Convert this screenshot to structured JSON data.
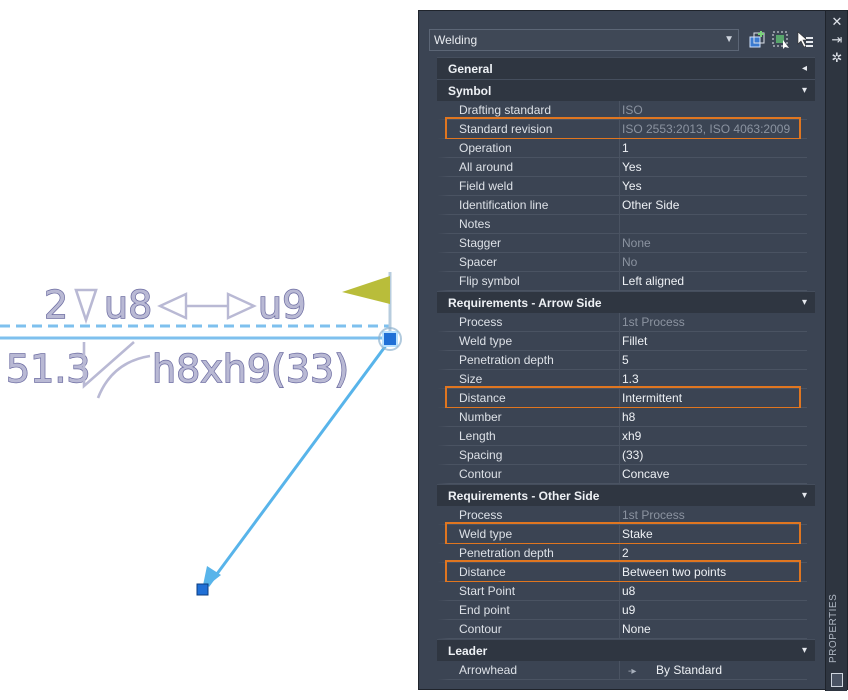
{
  "drawing": {
    "arrow_side_text": "2 u8 u9",
    "arrow_qty": "2",
    "arrow_start": "u8",
    "arrow_end": "u9",
    "other_side_size": "51.3",
    "other_side_dims": "h8xh9(33)",
    "colors": {
      "leader": "#58b4ea",
      "grip": "#1f6fd6",
      "flag": "#b9bd3a",
      "symbol_text": "#6a6aa0",
      "reference_line": "#7ec0ee"
    }
  },
  "palette": {
    "object_type": "Welding",
    "tools": [
      "quick-select-icon",
      "select-objects-icon",
      "toggle-pickadd-icon"
    ],
    "strip_label": "PROPERTIES",
    "sections": [
      {
        "title": "General",
        "toggle": "◂",
        "rows": []
      },
      {
        "title": "Symbol",
        "toggle": "▾",
        "rows": [
          {
            "label": "Drafting standard",
            "value": "ISO",
            "dim": true
          },
          {
            "label": "Standard revision",
            "value": "ISO 2553:2013, ISO 4063:2009",
            "dim": true,
            "highlight": true
          },
          {
            "label": "Operation",
            "value": "1"
          },
          {
            "label": "All around",
            "value": "Yes"
          },
          {
            "label": "Field weld",
            "value": "Yes"
          },
          {
            "label": "Identification line",
            "value": "Other Side"
          },
          {
            "label": "Notes",
            "value": ""
          },
          {
            "label": "Stagger",
            "value": "None",
            "dim": true
          },
          {
            "label": "Spacer",
            "value": "No",
            "dim": true
          },
          {
            "label": "Flip symbol",
            "value": "Left aligned"
          }
        ]
      },
      {
        "title": "Requirements - Arrow Side",
        "toggle": "▾",
        "rows": [
          {
            "label": "Process",
            "value": "1st Process",
            "dim": true
          },
          {
            "label": "Weld type",
            "value": "Fillet"
          },
          {
            "label": "Penetration depth",
            "value": "5"
          },
          {
            "label": "Size",
            "value": "1.3"
          },
          {
            "label": "Distance",
            "value": "Intermittent",
            "highlight": true
          },
          {
            "label": "Number",
            "value": "h8"
          },
          {
            "label": "Length",
            "value": "xh9"
          },
          {
            "label": "Spacing",
            "value": "(33)"
          },
          {
            "label": "Contour",
            "value": "Concave"
          }
        ]
      },
      {
        "title": "Requirements - Other Side",
        "toggle": "▾",
        "rows": [
          {
            "label": "Process",
            "value": "1st Process",
            "dim": true
          },
          {
            "label": "Weld type",
            "value": "Stake",
            "highlight": true
          },
          {
            "label": "Penetration depth",
            "value": "2"
          },
          {
            "label": "Distance",
            "value": "Between two points",
            "highlight": true
          },
          {
            "label": "Start Point",
            "value": "u8"
          },
          {
            "label": "End point",
            "value": "u9"
          },
          {
            "label": "Contour",
            "value": "None"
          }
        ]
      },
      {
        "title": "Leader",
        "toggle": "▾",
        "rows": [
          {
            "label": "Arrowhead",
            "value": "By Standard",
            "glyph": "-▸"
          }
        ]
      }
    ]
  }
}
